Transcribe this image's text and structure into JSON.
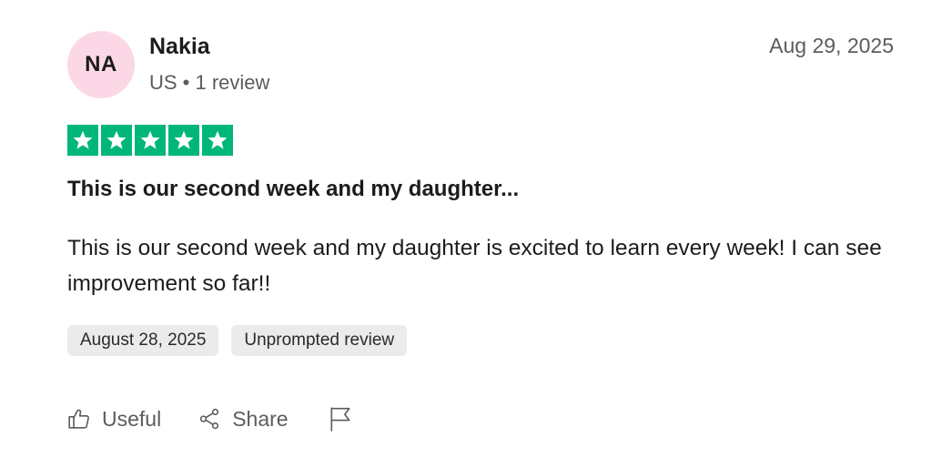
{
  "reviewer": {
    "initials": "NA",
    "name": "Nakia",
    "meta": "US • 1 review",
    "avatar_color": "#fcd8e6"
  },
  "review": {
    "date": "Aug 29, 2025",
    "rating": 5,
    "rating_max": 5,
    "star_color": "#00b67a",
    "title": "This is our second week and my daughter...",
    "body": "This is our second week and my daughter is excited to learn every week! I can see improvement so far!!"
  },
  "chips": {
    "experience_date": "August 28, 2025",
    "review_type": "Unprompted review"
  },
  "actions": {
    "useful_label": "Useful",
    "useful_icon": "thumbs-up-icon",
    "share_label": "Share",
    "share_icon": "share-icon",
    "flag_icon": "flag-icon"
  }
}
